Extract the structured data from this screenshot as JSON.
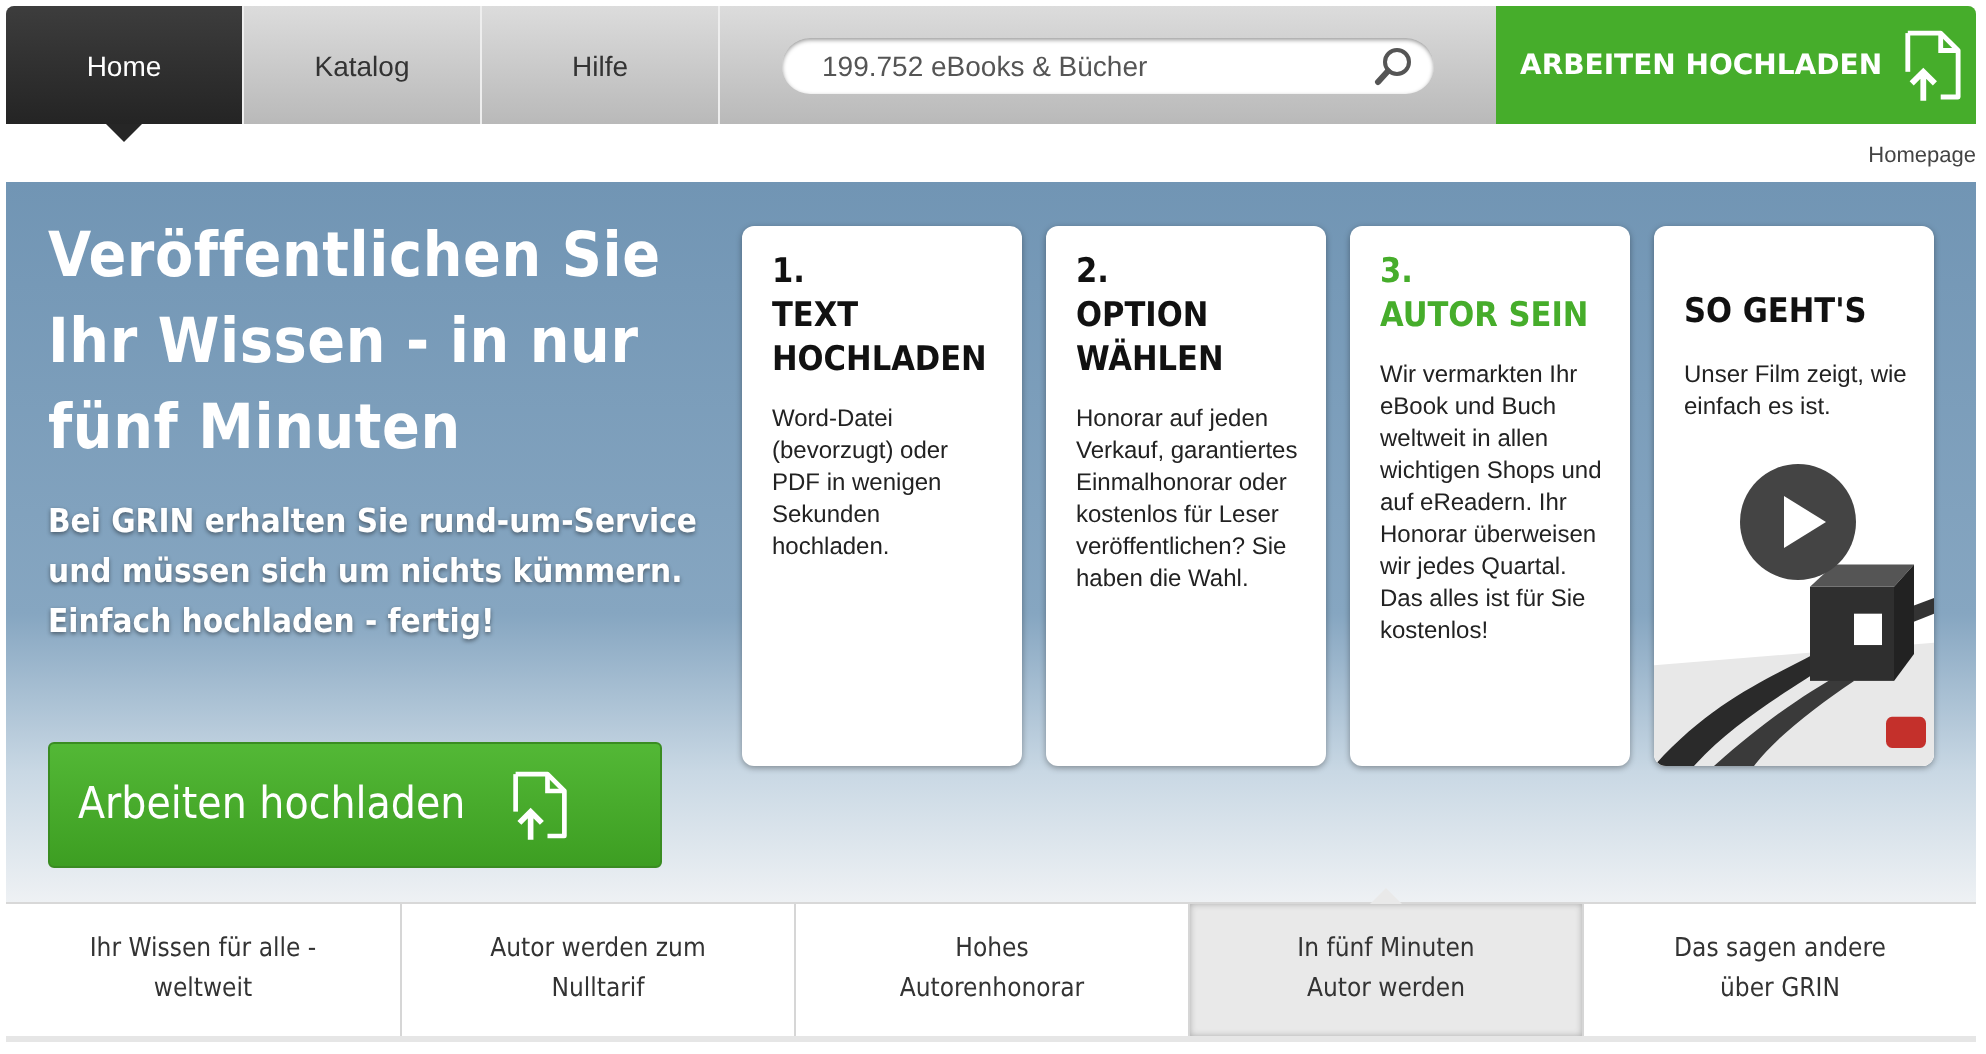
{
  "nav": {
    "tabs": [
      {
        "label": "Home",
        "selected": true
      },
      {
        "label": "Katalog",
        "selected": false
      },
      {
        "label": "Hilfe",
        "selected": false
      }
    ],
    "search": {
      "placeholder": "199.752 eBooks & Bücher"
    },
    "upload_button": "ARBEITEN HOCHLADEN"
  },
  "breadcrumb": "Homepage",
  "hero": {
    "headline": "Veröffentlichen Sie Ihr Wissen - in nur fünf Minuten",
    "subtitle": "Bei GRIN erhalten Sie rund-um-Service und müssen sich um nichts kümmern. Einfach hochladen - fertig!",
    "button": "Arbeiten hochladen",
    "cards": [
      {
        "kind": "step",
        "number": "1.",
        "title": "TEXT HOCHLADEN",
        "text": "Word-Datei (bevorzugt) oder PDF in wenigen Sekunden hochladen.",
        "highlighted": false
      },
      {
        "kind": "step",
        "number": "2.",
        "title": "OPTION WÄHLEN",
        "text": "Honorar auf jeden Verkauf, garantiertes Einmalhonorar oder kostenlos für Leser veröffentlichen? Sie haben die Wahl.",
        "highlighted": false
      },
      {
        "kind": "step",
        "number": "3.",
        "title": "AUTOR SEIN",
        "text": "Wir vermarkten Ihr eBook und Buch weltweit in allen wichtigen Shops und auf eReadern. Ihr Honorar überweisen wir jedes Quartal. Das alles ist für Sie kostenlos!",
        "highlighted": true
      },
      {
        "kind": "video",
        "title": "SO GEHT'S",
        "text": "Unser Film zeigt, wie einfach es ist."
      }
    ]
  },
  "feature_tabs": [
    {
      "label": "Ihr Wissen für alle - weltweit",
      "selected": false
    },
    {
      "label": "Autor werden zum Nulltarif",
      "selected": false
    },
    {
      "label": "Hohes Autorenhonorar",
      "selected": false
    },
    {
      "label": "In fünf Minuten Autor werden",
      "selected": true
    },
    {
      "label": "Das sagen andere über GRIN",
      "selected": false
    }
  ]
}
